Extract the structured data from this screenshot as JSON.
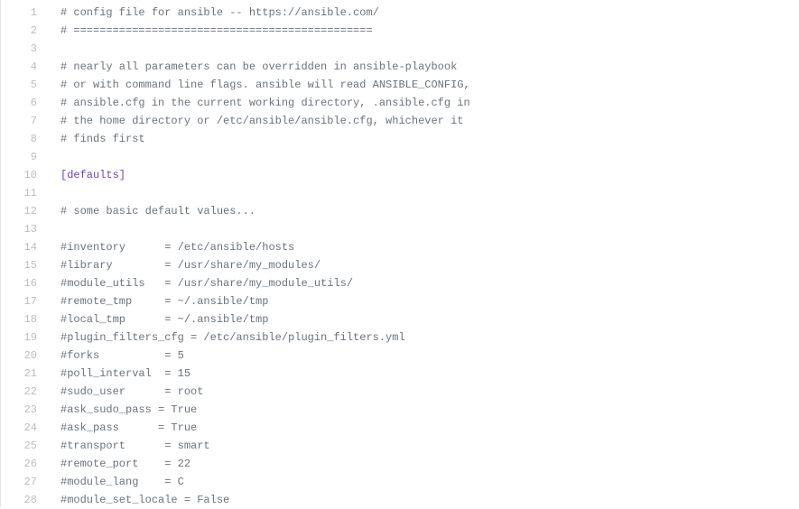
{
  "file": {
    "language": "ini",
    "lines": [
      {
        "n": 1,
        "cls": "tok-comment",
        "text": "# config file for ansible -- https://ansible.com/"
      },
      {
        "n": 2,
        "cls": "tok-comment",
        "text": "# =============================================="
      },
      {
        "n": 3,
        "cls": "",
        "text": ""
      },
      {
        "n": 4,
        "cls": "tok-comment",
        "text": "# nearly all parameters can be overridden in ansible-playbook"
      },
      {
        "n": 5,
        "cls": "tok-comment",
        "text": "# or with command line flags. ansible will read ANSIBLE_CONFIG,"
      },
      {
        "n": 6,
        "cls": "tok-comment",
        "text": "# ansible.cfg in the current working directory, .ansible.cfg in"
      },
      {
        "n": 7,
        "cls": "tok-comment",
        "text": "# the home directory or /etc/ansible/ansible.cfg, whichever it"
      },
      {
        "n": 8,
        "cls": "tok-comment",
        "text": "# finds first"
      },
      {
        "n": 9,
        "cls": "",
        "text": ""
      },
      {
        "n": 10,
        "cls": "tok-section",
        "text": "[defaults]"
      },
      {
        "n": 11,
        "cls": "",
        "text": ""
      },
      {
        "n": 12,
        "cls": "tok-comment",
        "text": "# some basic default values..."
      },
      {
        "n": 13,
        "cls": "",
        "text": ""
      },
      {
        "n": 14,
        "cls": "tok-comment",
        "text": "#inventory      = /etc/ansible/hosts"
      },
      {
        "n": 15,
        "cls": "tok-comment",
        "text": "#library        = /usr/share/my_modules/"
      },
      {
        "n": 16,
        "cls": "tok-comment",
        "text": "#module_utils   = /usr/share/my_module_utils/"
      },
      {
        "n": 17,
        "cls": "tok-comment",
        "text": "#remote_tmp     = ~/.ansible/tmp"
      },
      {
        "n": 18,
        "cls": "tok-comment",
        "text": "#local_tmp      = ~/.ansible/tmp"
      },
      {
        "n": 19,
        "cls": "tok-comment",
        "text": "#plugin_filters_cfg = /etc/ansible/plugin_filters.yml"
      },
      {
        "n": 20,
        "cls": "tok-comment",
        "text": "#forks          = 5"
      },
      {
        "n": 21,
        "cls": "tok-comment",
        "text": "#poll_interval  = 15"
      },
      {
        "n": 22,
        "cls": "tok-comment",
        "text": "#sudo_user      = root"
      },
      {
        "n": 23,
        "cls": "tok-comment",
        "text": "#ask_sudo_pass = True"
      },
      {
        "n": 24,
        "cls": "tok-comment",
        "text": "#ask_pass      = True"
      },
      {
        "n": 25,
        "cls": "tok-comment",
        "text": "#transport      = smart"
      },
      {
        "n": 26,
        "cls": "tok-comment",
        "text": "#remote_port    = 22"
      },
      {
        "n": 27,
        "cls": "tok-comment",
        "text": "#module_lang    = C"
      },
      {
        "n": 28,
        "cls": "tok-comment",
        "text": "#module_set_locale = False"
      }
    ]
  }
}
